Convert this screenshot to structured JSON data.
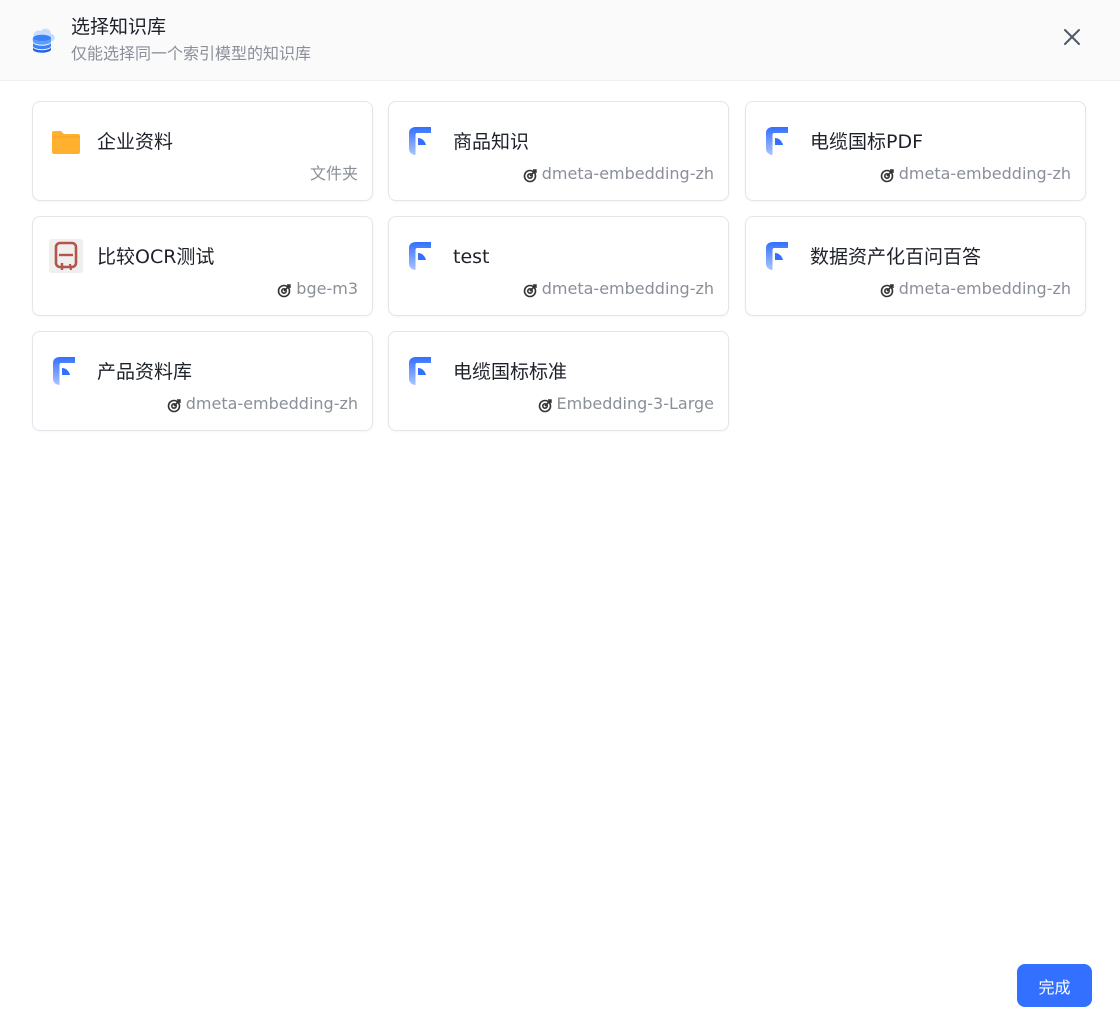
{
  "dialog": {
    "title": "选择知识库",
    "subtitle": "仅能选择同一个索引模型的知识库",
    "header_icon": "database-stack-icon",
    "close_icon": "close-icon"
  },
  "datasets": [
    {
      "name": "企业资料",
      "meta": "文件夹",
      "type": "folder",
      "icon": "folder-icon"
    },
    {
      "name": "商品知识",
      "meta": "dmeta-embedding-zh",
      "type": "dataset",
      "icon": "dataset-icon"
    },
    {
      "name": "电缆国标PDF",
      "meta": "dmeta-embedding-zh",
      "type": "dataset",
      "icon": "dataset-icon"
    },
    {
      "name": "比较OCR测试",
      "meta": "bge-m3",
      "type": "dataset",
      "icon": "custom-avatar-icon"
    },
    {
      "name": "test",
      "meta": "dmeta-embedding-zh",
      "type": "dataset",
      "icon": "dataset-icon"
    },
    {
      "name": "数据资产化百问百答",
      "meta": "dmeta-embedding-zh",
      "type": "dataset",
      "icon": "dataset-icon"
    },
    {
      "name": "产品资料库",
      "meta": "dmeta-embedding-zh",
      "type": "dataset",
      "icon": "dataset-icon"
    },
    {
      "name": "电缆国标标准",
      "meta": "Embedding-3-Large",
      "type": "dataset",
      "icon": "dataset-icon"
    }
  ],
  "footer": {
    "done_label": "完成"
  },
  "colors": {
    "primary": "#3370ff",
    "folder": "#ffb02e",
    "muted_text": "#8a8f99"
  }
}
